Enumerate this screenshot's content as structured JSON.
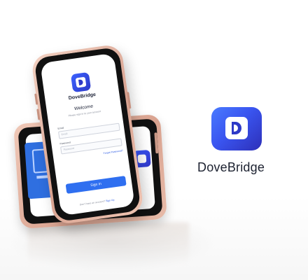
{
  "brand": {
    "name": "DoveBridge",
    "accent_color": "#3a55f0",
    "logo_icon": "dove-bridge-logo-icon"
  },
  "front_screen": {
    "app_name": "DoveBridge",
    "welcome_title": "Welcome",
    "subtitle": "Please sign in to your account",
    "email_label": "Email",
    "email_placeholder": "Email",
    "password_label": "Password",
    "password_placeholder": "Password",
    "forgot_link": "Forgot Password?",
    "sign_in_button": "Sign In",
    "signup_prompt": "Don't have an account?",
    "signup_link": "Sign Up"
  }
}
